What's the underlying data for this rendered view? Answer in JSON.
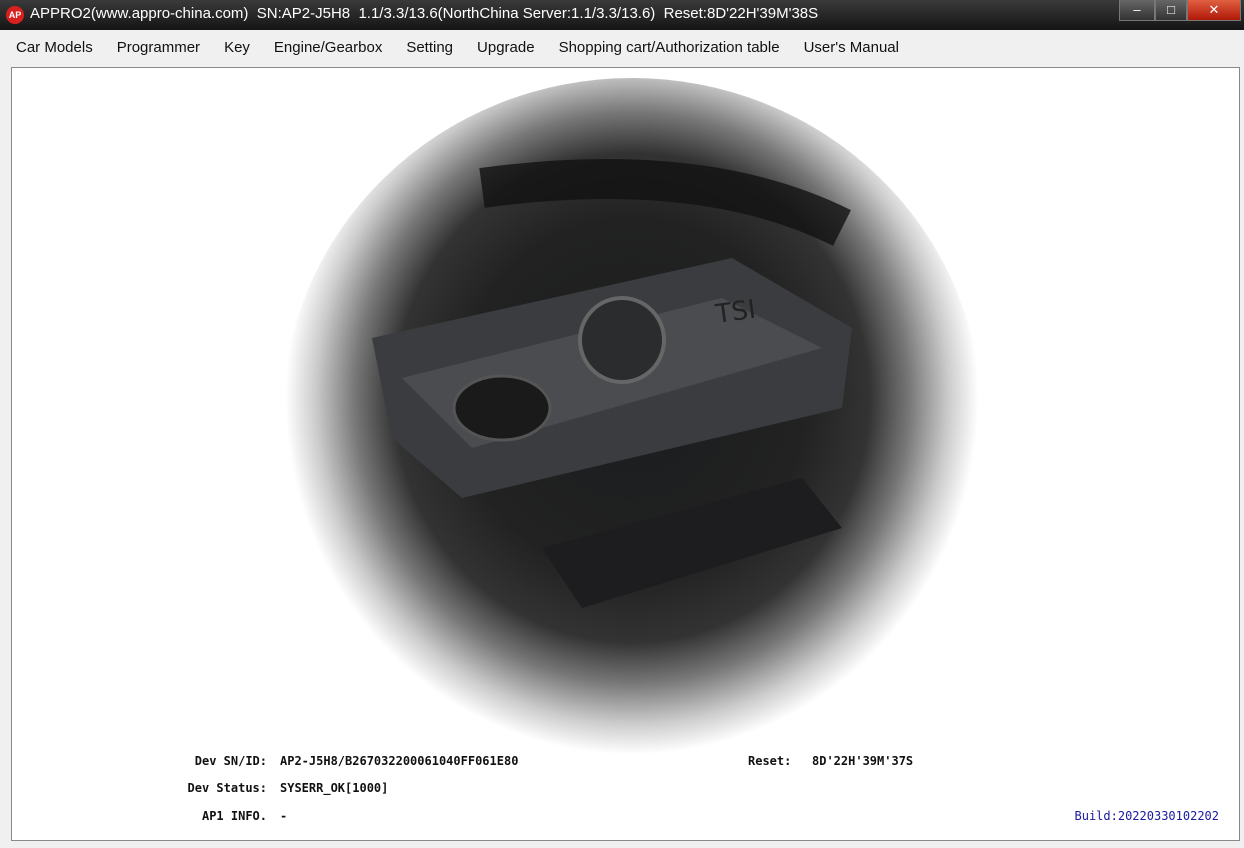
{
  "window": {
    "icon_text": "AP",
    "title": "APPRO2(www.appro-china.com)  SN:AP2-J5H8  1.1/3.3/13.6(NorthChina Server:1.1/3.3/13.6)  Reset:8D'22H'39M'38S",
    "minimize": "–",
    "maximize": "□",
    "close": "✕"
  },
  "menu": [
    "Car Models",
    "Programmer",
    "Key",
    "Engine/Gearbox",
    "Setting",
    "Upgrade",
    "Shopping cart/Authorization table",
    "User's Manual"
  ],
  "info": {
    "sn_label": "Dev SN/ID:",
    "sn_value": "AP2-J5H8/B267032200061040FF061E80",
    "status_label": "Dev Status:",
    "status_value": "SYSERR_OK[1000]",
    "ap1_label": "AP1 INFO.",
    "ap1_value": "-",
    "reset_label": "Reset:",
    "reset_value": "8D'22H'39M'37S",
    "build": "Build:20220330102202"
  },
  "image": {
    "badge_text": "TSI"
  }
}
